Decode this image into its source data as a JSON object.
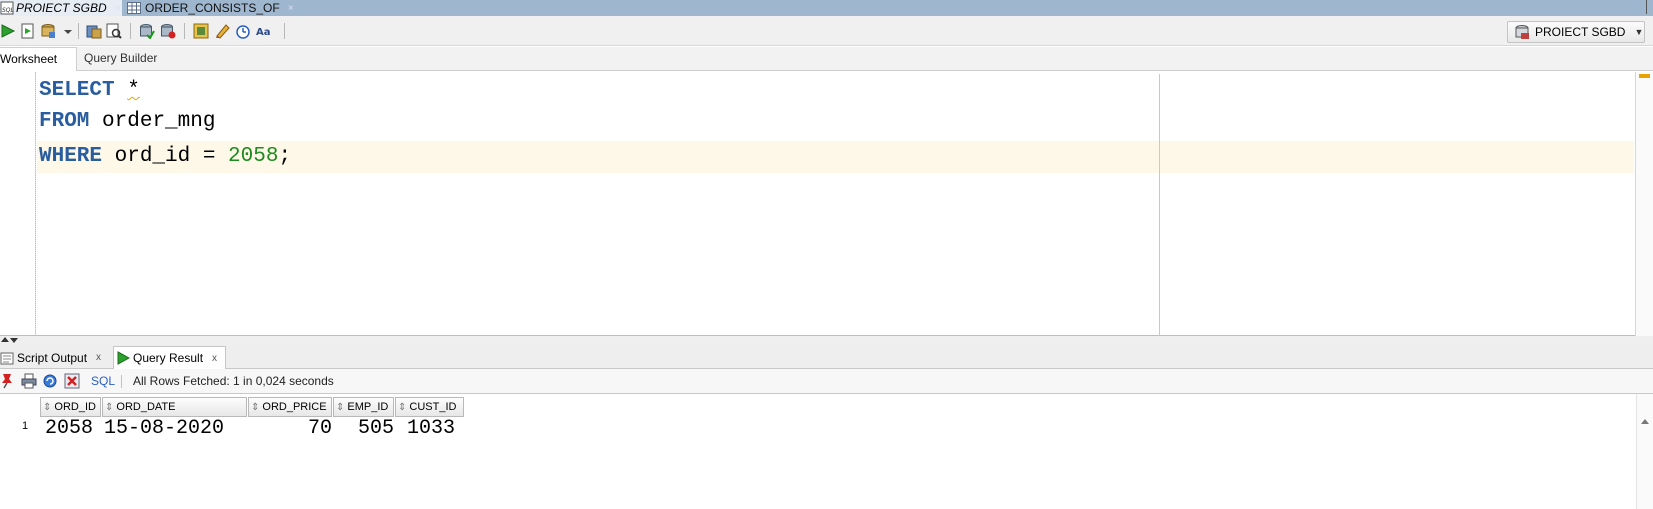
{
  "editor_tabs": [
    {
      "label": "PROIECT SGBD",
      "icon": "sql-worksheet-icon",
      "active": true
    },
    {
      "label": "ORDER_CONSISTS_OF",
      "icon": "table-icon",
      "active": false
    }
  ],
  "toolbar": {
    "buttons": [
      "run-statement-icon",
      "run-script-icon",
      "commit-icon",
      "rollback-icon",
      "explain-plan-icon",
      "autotrace-icon",
      "unshared-sql-icon",
      "clear-icon",
      "history-icon",
      "format-icon"
    ],
    "connection": "PROIECT SGBD"
  },
  "subtabs": {
    "worksheet": "Worksheet",
    "query_builder": "Query Builder"
  },
  "editor": {
    "line1": {
      "keyword": "SELECT",
      "rest": "*"
    },
    "line2": {
      "keyword": "FROM",
      "rest": "order_mng"
    },
    "line3": {
      "keyword": "WHERE",
      "rest": "ord_id = ",
      "number": "2058",
      "end": ";"
    },
    "colors": {
      "keyword": "#2a5d9f",
      "number": "#1f8a1f",
      "current_line": "#fdf8e8"
    }
  },
  "panel_tabs": {
    "script_output": "Script Output",
    "query_result": "Query Result",
    "close": "x"
  },
  "results": {
    "sql_label": "SQL",
    "status": "All Rows Fetched: 1 in 0,024 seconds",
    "columns": [
      "ORD_ID",
      "ORD_DATE",
      "ORD_PRICE",
      "EMP_ID",
      "CUST_ID"
    ],
    "rows": [
      {
        "num": "1",
        "cells": [
          "2058",
          "15-08-2020",
          "70",
          "505",
          "1033"
        ]
      }
    ]
  }
}
